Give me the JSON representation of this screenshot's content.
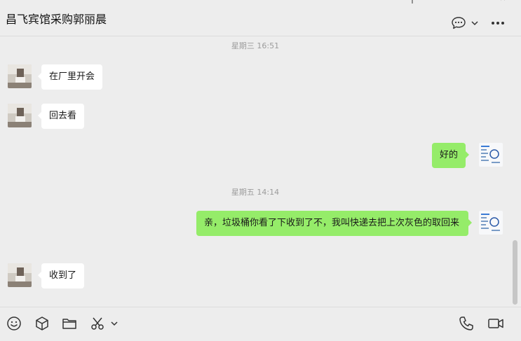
{
  "header": {
    "title": "昌飞宾馆采购郭丽晨",
    "icons": [
      "pin-icon",
      "minimize-icon",
      "maximize-icon",
      "close-icon",
      "chat-bubble-icon",
      "chevron-down-icon",
      "more-icon"
    ]
  },
  "messages": {
    "timestamp_1": "星期三 16:51",
    "timestamp_2": "星期五 14:14",
    "items": [
      {
        "side": "left",
        "text": "在厂里开会"
      },
      {
        "side": "left",
        "text": "回去看"
      },
      {
        "side": "right",
        "text": "好的"
      },
      {
        "side": "right",
        "text": "亲，垃圾桶你看了下收到了不，我叫快递去把上次灰色的取回来"
      },
      {
        "side": "left",
        "text": "收到了"
      }
    ]
  },
  "toolbar": {
    "icons": [
      "emoji-icon",
      "package-icon",
      "folder-icon",
      "scissors-icon",
      "chevron-down-icon",
      "phone-icon",
      "video-icon"
    ]
  },
  "colors": {
    "background": "#ededed",
    "bubble_in": "#ffffff",
    "bubble_out": "#95ec69",
    "timestamp": "#9c9c9c"
  }
}
